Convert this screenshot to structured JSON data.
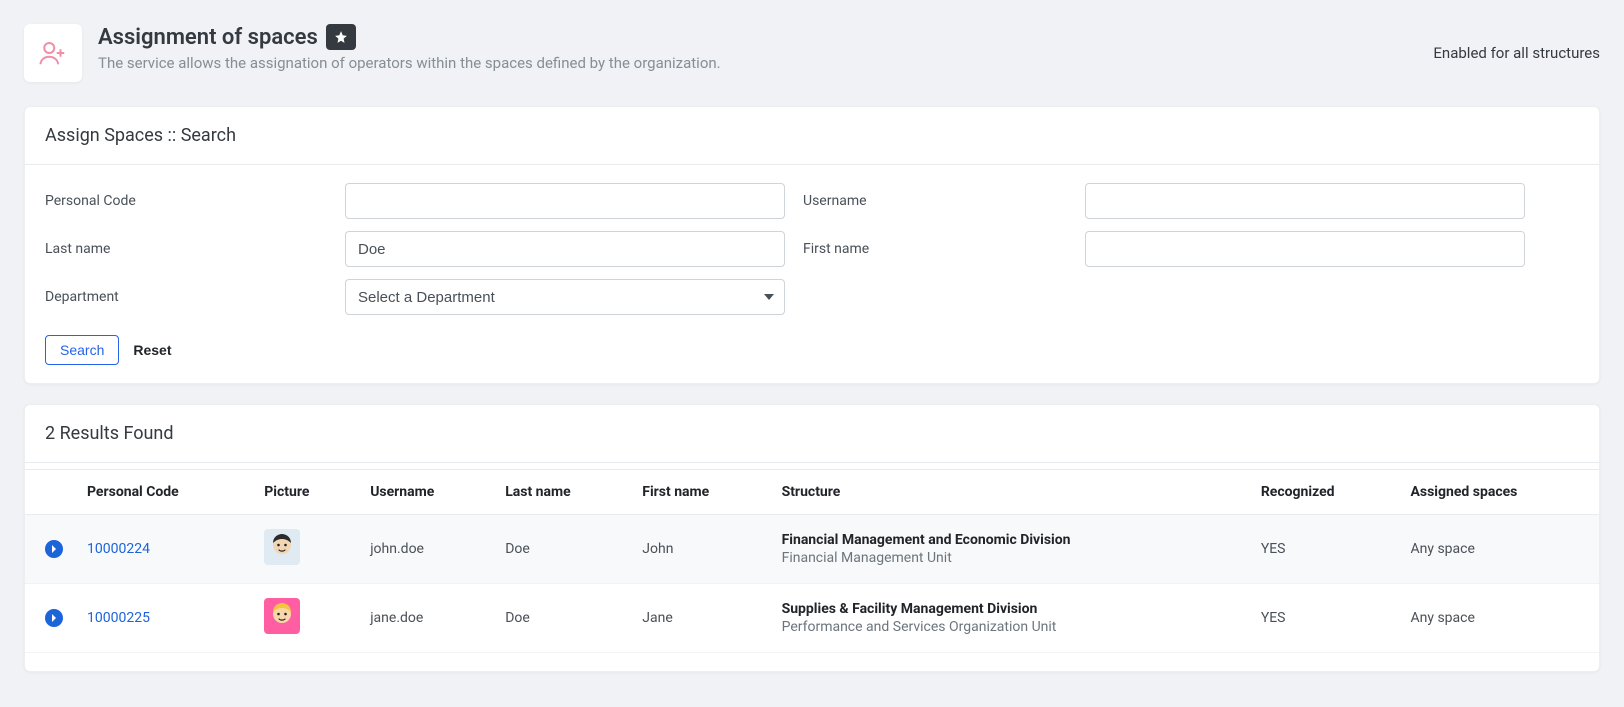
{
  "header": {
    "title": "Assignment of spaces",
    "subtitle": "The service allows the assignation of operators within the spaces defined by the organization.",
    "right_label": "Enabled for all structures"
  },
  "search": {
    "panel_title": "Assign Spaces :: Search",
    "labels": {
      "personal_code": "Personal Code",
      "username": "Username",
      "last_name": "Last name",
      "first_name": "First name",
      "department": "Department"
    },
    "values": {
      "personal_code": "",
      "username": "",
      "last_name": "Doe",
      "first_name": ""
    },
    "department_placeholder": "Select a Department",
    "buttons": {
      "search": "Search",
      "reset": "Reset"
    }
  },
  "results": {
    "title": "2 Results Found",
    "columns": {
      "personal_code": "Personal Code",
      "picture": "Picture",
      "username": "Username",
      "last_name": "Last name",
      "first_name": "First name",
      "structure": "Structure",
      "recognized": "Recognized",
      "assigned_spaces": "Assigned spaces"
    },
    "rows": [
      {
        "personal_code": "10000224",
        "username": "john.doe",
        "last_name": "Doe",
        "first_name": "John",
        "structure_main": "Financial Management and Economic Division",
        "structure_sub": "Financial Management Unit",
        "recognized": "YES",
        "assigned_spaces": "Any space",
        "avatar_bg": "#dfeaf3",
        "avatar_face": "#f2d6b3",
        "avatar_hair": "#2b2b2b"
      },
      {
        "personal_code": "10000225",
        "username": "jane.doe",
        "last_name": "Doe",
        "first_name": "Jane",
        "structure_main": "Supplies & Facility Management Division",
        "structure_sub": "Performance and Services Organization Unit",
        "recognized": "YES",
        "assigned_spaces": "Any space",
        "avatar_bg": "#ff5fa2",
        "avatar_face": "#f8d7a8",
        "avatar_hair": "#f5c542"
      }
    ]
  }
}
